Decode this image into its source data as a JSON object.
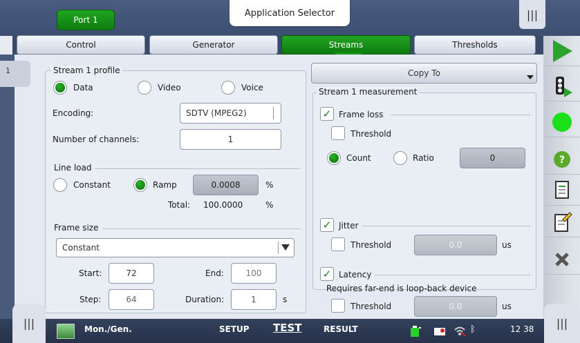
{
  "header": {
    "port_tab": "Port 1",
    "app_selector": "Application Selector",
    "menu_icon": "|||"
  },
  "tabs": [
    "Control",
    "Generator",
    "Streams",
    "Thresholds"
  ],
  "active_tab": "Streams",
  "stream_index": "1",
  "profile": {
    "legend": "Stream 1 profile",
    "options": [
      "Data",
      "Video",
      "Voice"
    ],
    "selected": "Data",
    "encoding_label": "Encoding:",
    "encoding_value": "SDTV (MPEG2)",
    "channels_label": "Number of channels:",
    "channels_value": "1"
  },
  "line_load": {
    "legend": "Line load",
    "constant_label": "Constant",
    "ramp_label": "Ramp",
    "selected": "Ramp",
    "ramp_value": "0.0008",
    "unit": "%",
    "total_label": "Total:",
    "total_value": "100.0000",
    "total_unit": "%"
  },
  "frame_size": {
    "legend": "Frame size",
    "mode": "Constant",
    "start_label": "Start:",
    "start_value": "72",
    "end_label": "End:",
    "end_value": "100",
    "step_label": "Step:",
    "step_value": "64",
    "duration_label": "Duration:",
    "duration_value": "1",
    "duration_unit": "s"
  },
  "copy_to": "Copy To",
  "measurement": {
    "legend": "Stream 1 measurement",
    "frame_loss_label": "Frame loss",
    "frame_loss_checked": true,
    "threshold_label": "Threshold",
    "count_label": "Count",
    "ratio_label": "Ratio",
    "count_selected": true,
    "count_value": "0",
    "jitter_label": "Jitter",
    "jitter_checked": true,
    "jitter_threshold_label": "Threshold",
    "jitter_value": "0.0",
    "jitter_unit": "us",
    "latency_label": "Latency",
    "latency_checked": true,
    "latency_note": "Requires far-end is loop-back device",
    "latency_threshold_label": "Threshold",
    "latency_value": "0.0",
    "latency_unit": "us"
  },
  "bottom": {
    "app_name": "Mon./Gen.",
    "setup": "SETUP",
    "test": "TEST",
    "result": "RESULT",
    "time": "12 38",
    "menu_icon": "|||"
  },
  "colors": {
    "accent_green": "#1a9a1a",
    "header_blue": "#3d4f70"
  },
  "sidebar_icons": [
    "play-icon",
    "traffic-light-icon",
    "status-led-icon",
    "help-icon",
    "report-icon",
    "edit-report-icon",
    "tools-icon"
  ]
}
